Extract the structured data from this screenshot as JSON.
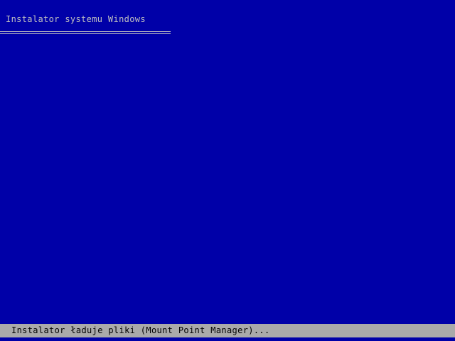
{
  "header": {
    "title": "Instalator systemu Windows"
  },
  "status_bar": {
    "text": "Instalator ładuje pliki (Mount Point Manager)..."
  },
  "colors": {
    "background": "#0000a8",
    "header_text": "#c0c0c0",
    "status_bar_background": "#aaaaaa",
    "status_text": "#000000"
  }
}
